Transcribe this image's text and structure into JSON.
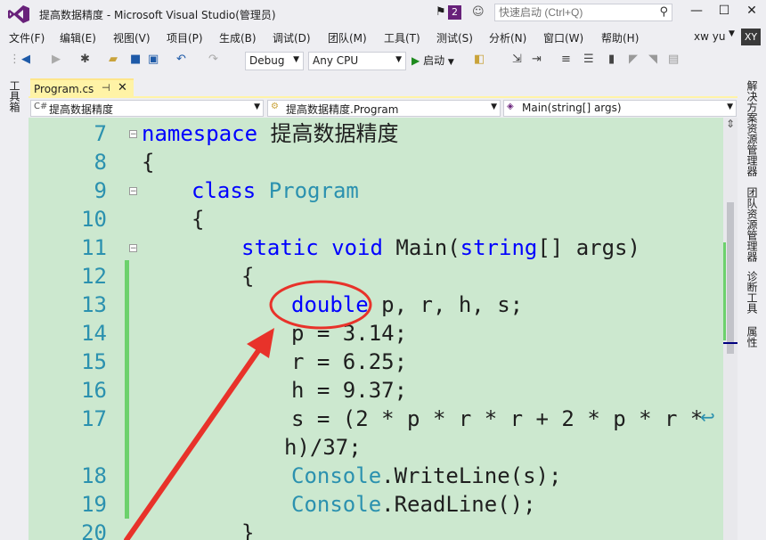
{
  "window": {
    "title": "提高数据精度 - Microsoft Visual Studio(管理员)",
    "notification_count": "2",
    "quick_launch_placeholder": "快速启动 (Ctrl+Q)",
    "minimize": "—",
    "maximize": "☐",
    "close": "✕"
  },
  "menu": [
    "文件(F)",
    "编辑(E)",
    "视图(V)",
    "项目(P)",
    "生成(B)",
    "调试(D)",
    "团队(M)",
    "工具(T)",
    "测试(S)",
    "分析(N)",
    "窗口(W)",
    "帮助(H)"
  ],
  "user": {
    "name": "xw yu",
    "initials": "XY"
  },
  "toolbar": {
    "config": "Debug",
    "platform": "Any CPU",
    "start_label": "启动",
    "start_icon": "▶"
  },
  "side_panels": {
    "left": [
      "工具箱"
    ],
    "right": [
      "解决方案资源管理器",
      "团队资源管理器",
      "诊断工具",
      "属性"
    ]
  },
  "tab": {
    "label": "Program.cs",
    "pin": "⊣",
    "close": "✕"
  },
  "navbar": {
    "project": "提高数据精度",
    "class": "提高数据精度.Program",
    "member": "Main(string[] args)"
  },
  "code_lines": [
    {
      "num": "7",
      "text": "namespace 提高数据精度"
    },
    {
      "num": "8",
      "text": "{"
    },
    {
      "num": "9",
      "text": "class Program"
    },
    {
      "num": "10",
      "text": "{"
    },
    {
      "num": "11",
      "text": "static void Main(string[] args)"
    },
    {
      "num": "12",
      "text": "{"
    },
    {
      "num": "13",
      "text": "double p, r, h, s;"
    },
    {
      "num": "14",
      "text": "p = 3.14;"
    },
    {
      "num": "15",
      "text": "r = 6.25;"
    },
    {
      "num": "16",
      "text": "h = 9.37;"
    },
    {
      "num": "17",
      "text": "s = (2 * p * r * r + 2 * p * r *"
    },
    {
      "num": "",
      "text": "h)/37;"
    },
    {
      "num": "18",
      "text": "Console.WriteLine(s);"
    },
    {
      "num": "19",
      "text": "Console.ReadLine();"
    },
    {
      "num": "20",
      "text": "}"
    }
  ],
  "colors": {
    "accent": "#68217a",
    "editor_bg": "#cce8cf",
    "keyword": "#0000ff",
    "type": "#2b91af",
    "annotation": "#e8322a"
  }
}
